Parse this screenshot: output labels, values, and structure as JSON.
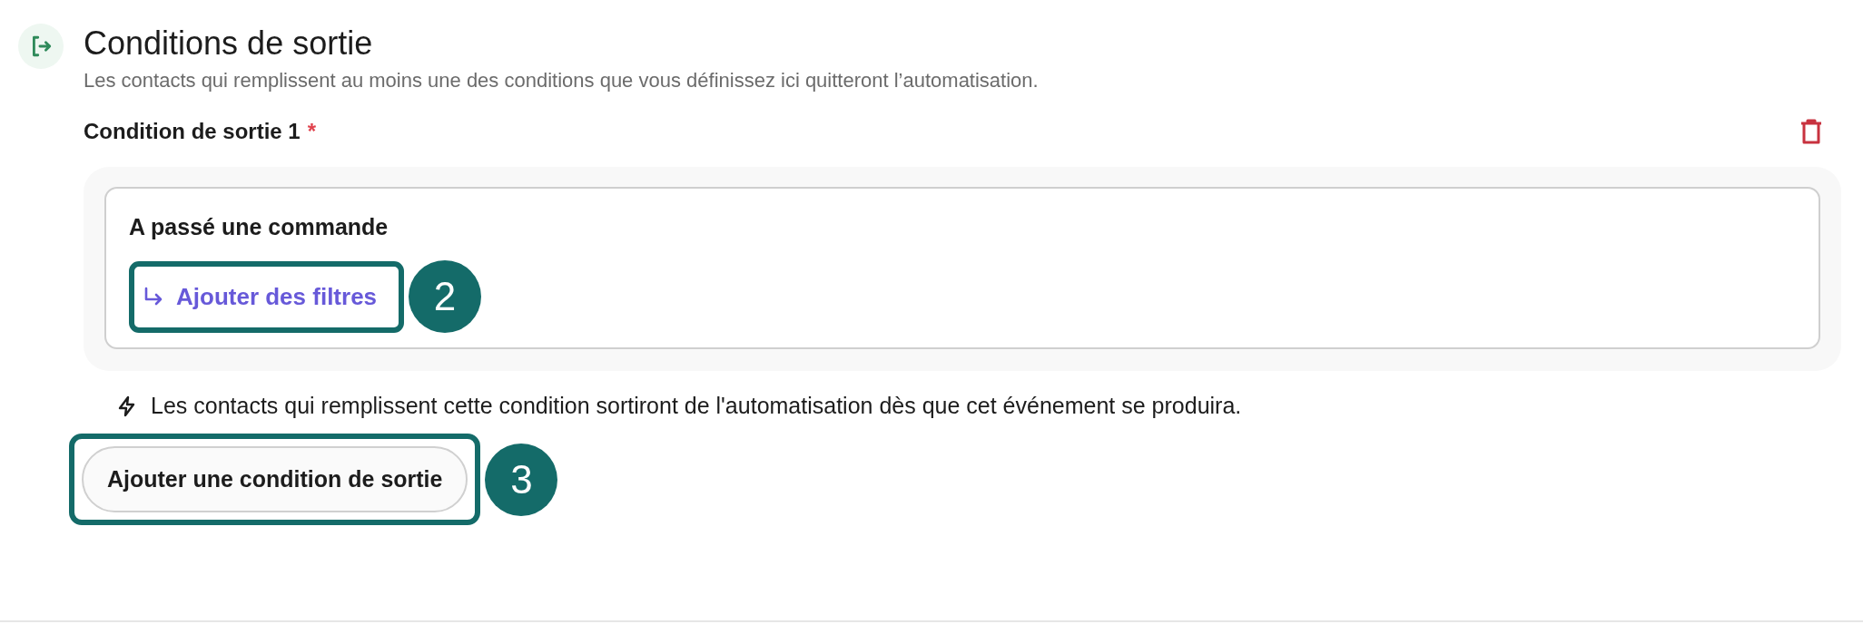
{
  "section": {
    "title": "Conditions de sortie",
    "description": "Les contacts qui remplissent au moins une des conditions que vous définissez ici quitteront l’automatisation."
  },
  "conditions": [
    {
      "label": "Condition de sortie 1",
      "required_mark": "*",
      "event": "A passé une commande",
      "filter_link": {
        "label": "Ajouter des filtres",
        "callout": "2"
      },
      "note": "Les contacts qui remplissent cette condition sortiront de l'automatisation dès que cet événement se produira."
    }
  ],
  "add_button": {
    "label": "Ajouter une condition de sortie",
    "callout": "3"
  }
}
